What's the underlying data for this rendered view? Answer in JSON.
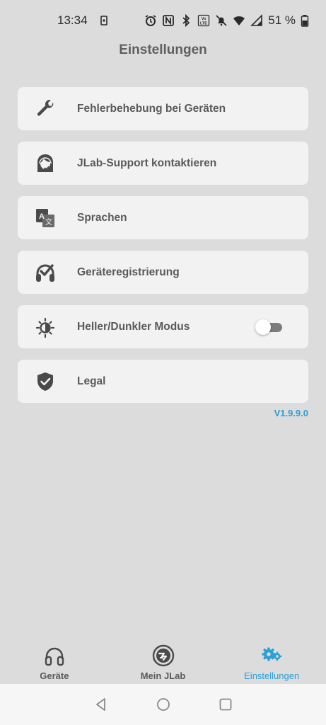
{
  "status_bar": {
    "time": "13:34",
    "battery_text": "51 %",
    "icons": [
      "screen-record-icon",
      "alarm-icon",
      "nfc-icon",
      "bluetooth-icon",
      "volte-icon",
      "mute-icon",
      "wifi-icon",
      "signal-icon",
      "battery-icon"
    ]
  },
  "header": {
    "title": "Einstellungen"
  },
  "menu": {
    "items": [
      {
        "label": "Fehlerbehebung bei Geräten",
        "icon": "wrench-icon"
      },
      {
        "label": "JLab-Support kontaktieren",
        "icon": "support-agent-icon"
      },
      {
        "label": "Sprachen",
        "icon": "translate-icon"
      },
      {
        "label": "Geräteregistrierung",
        "icon": "headphones-check-icon"
      },
      {
        "label": "Heller/Dunkler Modus",
        "icon": "brightness-icon",
        "toggle_on": false
      },
      {
        "label": "Legal",
        "icon": "shield-check-icon"
      }
    ]
  },
  "version": "V1.9.9.0",
  "bottom_nav": {
    "items": [
      {
        "label": "Geräte",
        "icon": "headphones-icon",
        "active": false
      },
      {
        "label": "Mein JLab",
        "icon": "jlab-logo-icon",
        "active": false
      },
      {
        "label": "Einstellungen",
        "icon": "gears-icon",
        "active": true
      }
    ]
  },
  "colors": {
    "background": "#dcdcdc",
    "card": "#f2f2f2",
    "accent": "#2a9fd8",
    "text": "#5a5a5a"
  }
}
